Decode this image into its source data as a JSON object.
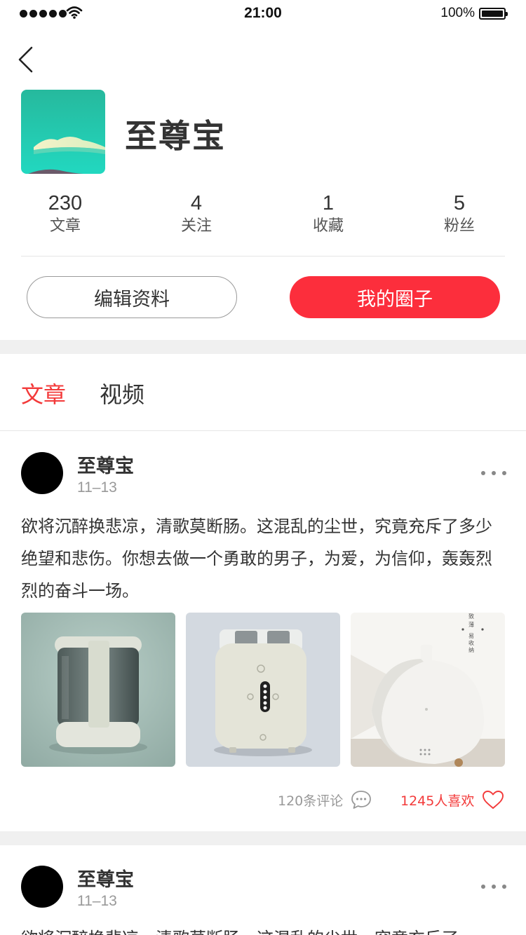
{
  "status_bar": {
    "time": "21:00",
    "battery": "100%"
  },
  "profile": {
    "name": "至尊宝",
    "stats": [
      {
        "value": "230",
        "label": "文章"
      },
      {
        "value": "4",
        "label": "关注"
      },
      {
        "value": "1",
        "label": "收藏"
      },
      {
        "value": "5",
        "label": "粉丝"
      }
    ],
    "edit_button": "编辑资料",
    "circle_button": "我的圈子"
  },
  "tabs": [
    {
      "label": "文章",
      "active": true
    },
    {
      "label": "视频",
      "active": false
    }
  ],
  "colors": {
    "accent": "#fc2e3c",
    "active_tab": "#f33a3a",
    "text": "#333333",
    "muted": "#999999"
  },
  "posts": [
    {
      "author": "至尊宝",
      "date": "11–13",
      "text": "欲将沉醉换悲凉，清歌莫断肠。这混乱的尘世，究竟充斥了多少绝望和悲伤。你想去做一个勇敢的男子，为爱，为信仰，轰轰烈烈的奋斗一场。",
      "images": [
        "kettle-photo",
        "toaster-photo",
        "humidifier-photo"
      ],
      "humidifier_caption": [
        "致",
        "薄",
        "易",
        "收",
        "纳"
      ],
      "comments": "120条评论",
      "likes": "1245人喜欢"
    },
    {
      "author": "至尊宝",
      "date": "11–13",
      "text": "欲将沉醉换悲凉，清歌莫断肠。这混乱的尘世，究竟充斥了"
    }
  ]
}
